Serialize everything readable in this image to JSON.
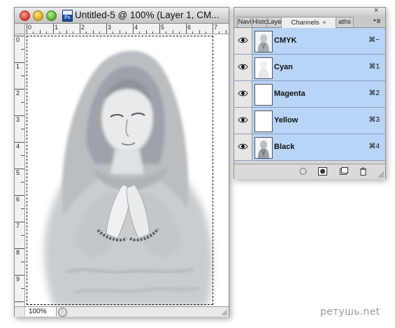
{
  "document": {
    "title": "Untitled-5 @ 100% (Layer 1, CM...",
    "app_icon": "photoshop-document-icon",
    "zoom": "100%",
    "ruler_h_labels": [
      "0",
      "1",
      "2",
      "3",
      "4",
      "5",
      "6",
      "7"
    ],
    "ruler_v_labels": [
      "0",
      "1",
      "2",
      "3",
      "4",
      "5",
      "6",
      "7",
      "8",
      "9"
    ]
  },
  "panel": {
    "tabs": [
      {
        "label": "Navi"
      },
      {
        "label": "Histo"
      },
      {
        "label": "Laye"
      },
      {
        "label": "Channels",
        "active": true
      },
      {
        "label": "aths"
      }
    ],
    "close_glyph": "×",
    "channels": [
      {
        "name": "CMYK",
        "shortcut": "⌘~"
      },
      {
        "name": "Cyan",
        "shortcut": "⌘1"
      },
      {
        "name": "Magenta",
        "shortcut": "⌘2"
      },
      {
        "name": "Yellow",
        "shortcut": "⌘3"
      },
      {
        "name": "Black",
        "shortcut": "⌘4"
      }
    ],
    "bottom_buttons": [
      "load-selection-icon",
      "save-selection-icon",
      "new-channel-icon",
      "trash-icon"
    ]
  },
  "colors": {
    "selection_blue": "#b8d4f6"
  },
  "watermark": "ретушь.net"
}
